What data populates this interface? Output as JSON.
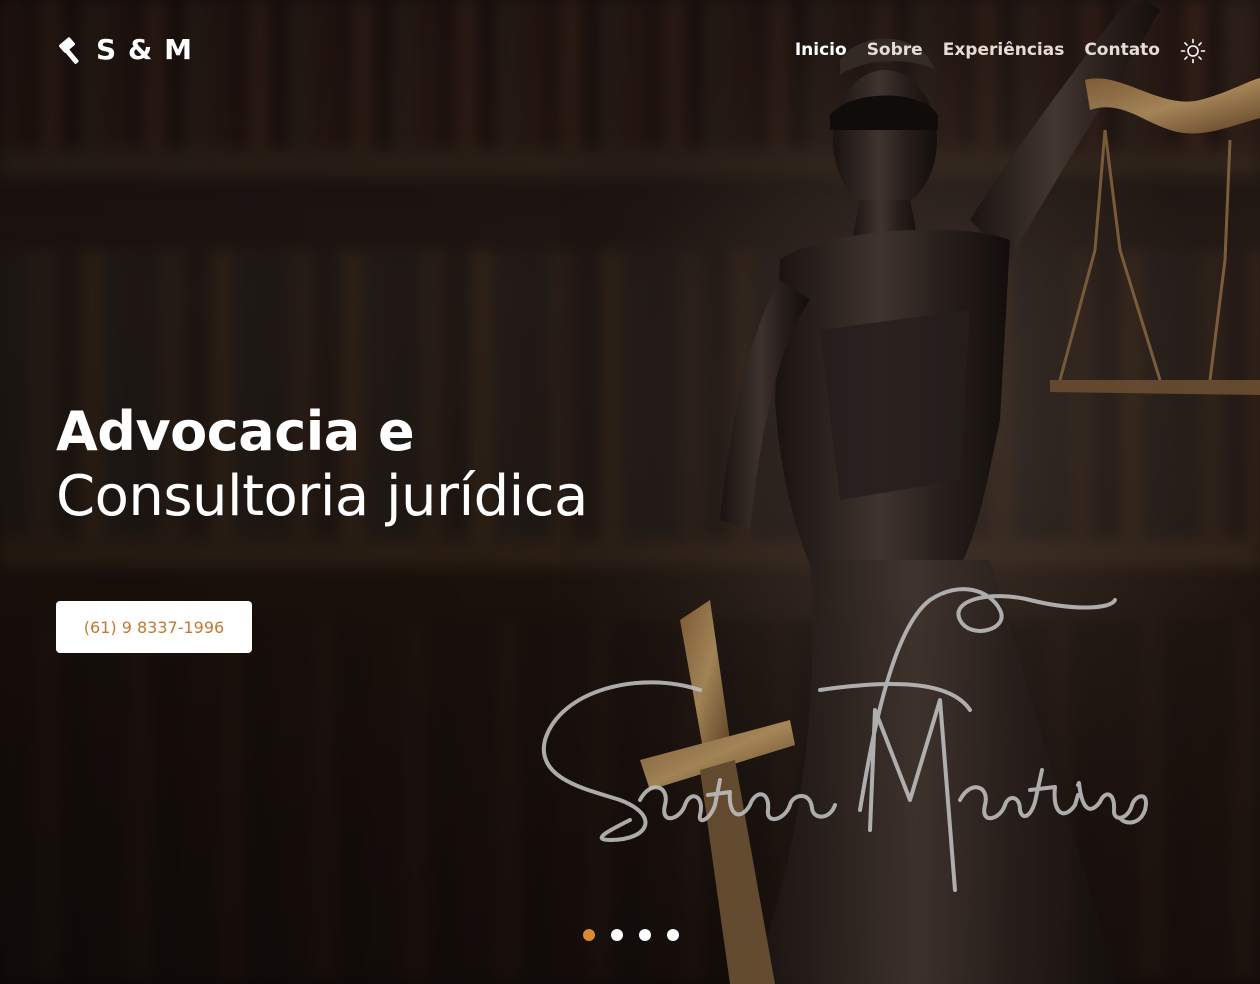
{
  "brand": {
    "logo_text": "S & M",
    "icon": "gavel-icon"
  },
  "nav": {
    "items": [
      {
        "label": "Inicio",
        "active": true
      },
      {
        "label": "Sobre",
        "active": false
      },
      {
        "label": "Experiências",
        "active": false
      },
      {
        "label": "Contato",
        "active": false
      }
    ],
    "theme_toggle_icon": "sun-icon"
  },
  "hero": {
    "title_strong": "Advocacia e",
    "title_light": "Consultoria jurídica",
    "phone_button": "(61) 9 8337-1996",
    "signature": "Santana Martins"
  },
  "carousel": {
    "total_slides": 4,
    "active_index": 0
  },
  "colors": {
    "accent": "#d98a2f",
    "phone_text": "#c07a30",
    "button_bg": "#ffffff"
  }
}
